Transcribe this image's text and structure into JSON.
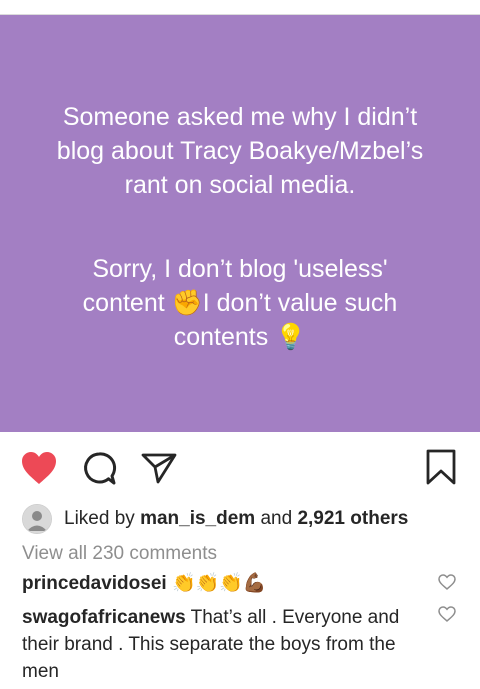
{
  "post": {
    "text_lines_1": [
      "Someone asked me why I didn’t",
      "blog about Tracy Boakye/Mzbel’s",
      "rant on social media."
    ],
    "text_lines_2": [
      "Sorry, I don’t blog 'useless'",
      "content ✊I don’t value such",
      "contents 💡"
    ],
    "background_color": "#a37fc3"
  },
  "actions": {
    "like_icon": "heart-filled-icon",
    "comment_icon": "comment-icon",
    "share_icon": "share-icon",
    "save_icon": "bookmark-icon",
    "like_color": "#ed4956"
  },
  "likes": {
    "prefix": "Liked by",
    "user": "man_is_dem",
    "conjunction": "and",
    "others": "2,921 others"
  },
  "comments": {
    "view_all": "View all 230 comments",
    "items": [
      {
        "user": "princedavidosei",
        "text": "👏👏👏💪🏾"
      },
      {
        "user": "swagofafricanews",
        "text": "That’s all . Everyone and their brand . This separate the boys from the men"
      }
    ]
  }
}
